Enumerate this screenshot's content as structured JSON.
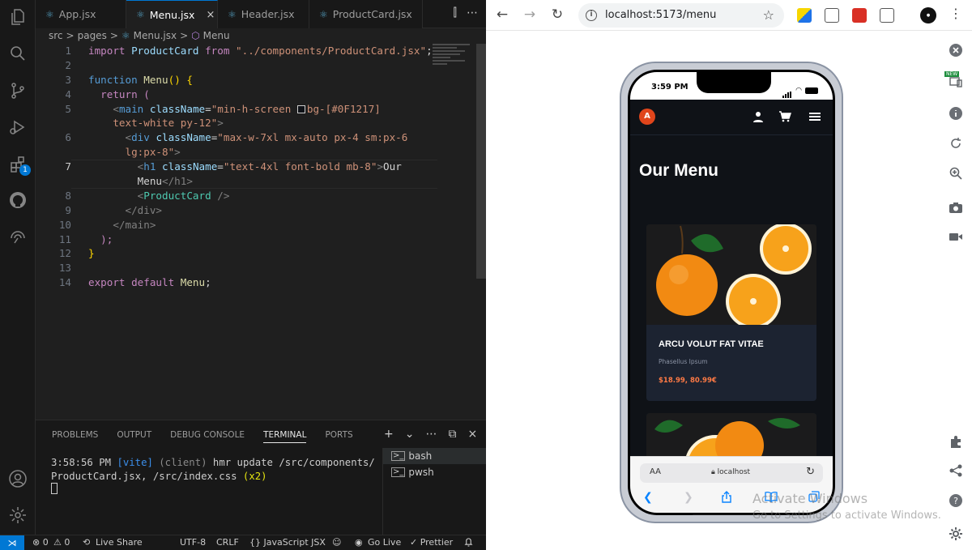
{
  "vscode": {
    "tabs": [
      {
        "label": "App.jsx",
        "active": false
      },
      {
        "label": "Menu.jsx",
        "active": true
      },
      {
        "label": "Header.jsx",
        "active": false
      },
      {
        "label": "ProductCard.jsx",
        "active": false
      }
    ],
    "tab_close": "×",
    "tab_actions": [
      "⫿",
      "⋯"
    ],
    "breadcrumb": {
      "src": "src",
      "sep": ">",
      "pages": "pages",
      "file": "Menu.jsx",
      "symbol": "Menu"
    },
    "line_numbers": [
      "1",
      "2",
      "3",
      "4",
      "5",
      "",
      "6",
      "",
      "7",
      "",
      "8",
      "9",
      "10",
      "11",
      "12",
      "13",
      "14"
    ],
    "code": {
      "l1_import": "import",
      "l1_name": "ProductCard",
      "l1_from": "from",
      "l1_path": "\"../components/ProductCard.jsx\"",
      "l1_semi": ";",
      "l3_function": "function",
      "l3_name": "Menu",
      "l3_parens": "()",
      "l3_brace": "{",
      "l4_return": "return",
      "l4_paren": "(",
      "l5_open": "<",
      "l5_tag": "main",
      "l5_attr": "className",
      "l5_eq": "=",
      "l5_val_a": "\"min-h-screen ",
      "l5_val_b": "bg-[#0F1217]",
      "l5_val_c": "text-white py-12\"",
      "l5_close": ">",
      "l6_tag": "div",
      "l6_attr": "className",
      "l6_val_a": "\"max-w-7xl mx-auto px-4 sm:px-6",
      "l6_val_b": "lg:px-8\"",
      "l7_tag": "h1",
      "l7_attr": "className",
      "l7_val": "\"text-4xl font-bold mb-8\"",
      "l7_text_a": "Our",
      "l7_text_b": "Menu",
      "l7_close_tag": "</h1>",
      "l8_comp": "ProductCard",
      "l8_self": "/>",
      "l9_close": "</div>",
      "l10_close": "</main>",
      "l11_close": ");",
      "l12_close": "}",
      "l14_export": "export",
      "l14_default": "default",
      "l14_name": "Menu",
      "l14_semi": ";"
    },
    "panel": {
      "tabs": [
        "PROBLEMS",
        "OUTPUT",
        "DEBUG CONSOLE",
        "TERMINAL",
        "PORTS"
      ],
      "active_tab": "TERMINAL",
      "actions": [
        "+",
        "⌄",
        "⋯",
        "⧉",
        "×"
      ],
      "terminal_time": "3:58:56 PM",
      "terminal_vite": "[vite]",
      "terminal_client": "(client)",
      "terminal_msg_a": "hmr update /src/components/",
      "terminal_msg_b": "ProductCard.jsx, /src/index.css",
      "terminal_count": "(x2)",
      "terminals": [
        "bash",
        "pwsh"
      ]
    },
    "statusbar": {
      "remote": "⋊",
      "errors": "⊗ 0",
      "warnings": "⚠ 0",
      "live_share": "Live Share",
      "encoding": "UTF-8",
      "eol": "CRLF",
      "language": "{} JavaScript JSX",
      "go_live": "Go Live",
      "prettier": "✓ Prettier",
      "bell": "🔔"
    }
  },
  "browser": {
    "url": "localhost:5173/menu",
    "ext_new_badge": "NEW",
    "watermark_title": "Activate Windows",
    "watermark_sub": "Go to Settings to activate Windows."
  },
  "phone": {
    "time": "3:59 PM",
    "logo_letter": "A",
    "page_title": "Our Menu",
    "product": {
      "title": "ARCU VOLUT FAT VITAE",
      "subtitle": "Phasellus Ipsum",
      "price": "$18.99, 80.99€"
    },
    "safari": {
      "aa": "AA",
      "host": "localhost"
    },
    "colors": {
      "bg": "#0f1217",
      "card": "#1c2331",
      "accent": "#ff7a45",
      "logo": "#e0451b"
    }
  }
}
